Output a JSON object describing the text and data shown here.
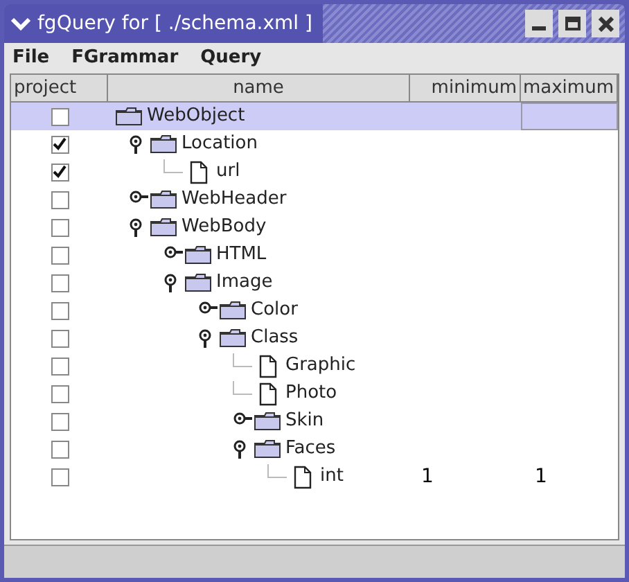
{
  "window": {
    "title": "fgQuery for [ ./schema.xml ]"
  },
  "menu": [
    "File",
    "FGrammar",
    "Query"
  ],
  "table": {
    "columns": [
      "project",
      "name",
      "minimum",
      "maximum"
    ],
    "tree": [
      {
        "name": "WebObject",
        "kind": "folder",
        "checked": false,
        "selected": true,
        "children": [
          {
            "name": "Location",
            "kind": "folder",
            "checked": true,
            "selected": false,
            "expanded": true,
            "children": [
              {
                "name": "url",
                "kind": "file",
                "checked": true,
                "selected": false
              }
            ]
          },
          {
            "name": "WebHeader",
            "kind": "folder",
            "checked": false,
            "selected": false,
            "expanded": false
          },
          {
            "name": "WebBody",
            "kind": "folder",
            "checked": false,
            "selected": false,
            "expanded": true,
            "children": [
              {
                "name": "HTML",
                "kind": "folder",
                "checked": false,
                "selected": false,
                "expanded": false
              },
              {
                "name": "Image",
                "kind": "folder",
                "checked": false,
                "selected": false,
                "expanded": true,
                "children": [
                  {
                    "name": "Color",
                    "kind": "folder",
                    "checked": false,
                    "selected": false,
                    "expanded": false
                  },
                  {
                    "name": "Class",
                    "kind": "folder",
                    "checked": false,
                    "selected": false,
                    "expanded": true,
                    "children": [
                      {
                        "name": "Graphic",
                        "kind": "file",
                        "checked": false,
                        "selected": false
                      },
                      {
                        "name": "Photo",
                        "kind": "file",
                        "checked": false,
                        "selected": false
                      },
                      {
                        "name": "Skin",
                        "kind": "folder",
                        "checked": false,
                        "selected": false,
                        "expanded": false
                      },
                      {
                        "name": "Faces",
                        "kind": "folder",
                        "checked": false,
                        "selected": false,
                        "expanded": true,
                        "children": [
                          {
                            "name": "int",
                            "kind": "file",
                            "checked": false,
                            "selected": false,
                            "minimum": "1",
                            "maximum": "1"
                          }
                        ]
                      }
                    ]
                  }
                ]
              }
            ]
          }
        ]
      }
    ]
  }
}
